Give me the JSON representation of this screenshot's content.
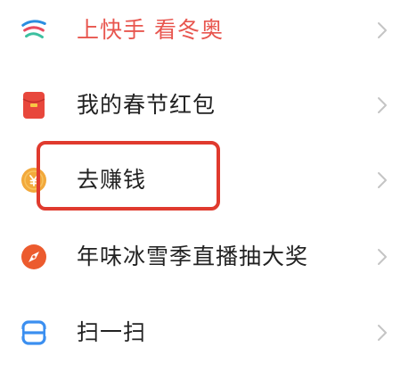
{
  "menu": {
    "items": [
      {
        "label": "上快手 看冬奥",
        "icon": "winter-olympics-logo-icon",
        "label_color": "#e8564f"
      },
      {
        "label": "我的春节红包",
        "icon": "red-envelope-icon",
        "label_color": "#222222"
      },
      {
        "label": "去赚钱",
        "icon": "gold-coin-icon",
        "label_color": "#222222"
      },
      {
        "label": "年味冰雪季直播抽大奖",
        "icon": "compass-icon",
        "label_color": "#222222"
      },
      {
        "label": "扫一扫",
        "icon": "scan-icon",
        "label_color": "#222222"
      }
    ]
  },
  "colors": {
    "highlight_box": "#e03a2e",
    "red_envelope": "#e8473c",
    "coin": "#f2a93b",
    "compass": "#ec5b2e",
    "scan": "#3b8ff0",
    "chevron": "#c4c4c4"
  }
}
